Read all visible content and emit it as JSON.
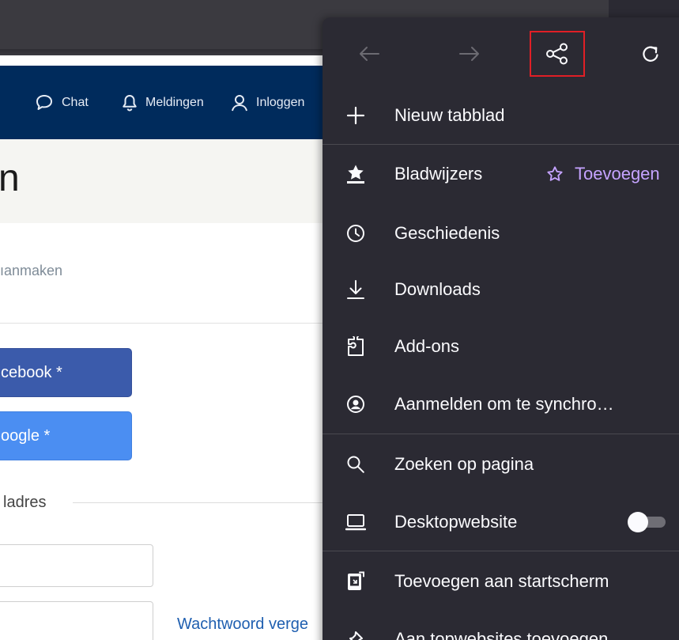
{
  "site": {
    "nav": {
      "chat_label": "Chat",
      "notifications_label": "Meldingen",
      "login_label": "Inloggen"
    },
    "hero_text": "n",
    "create_account_text": "ıanmaken",
    "facebook_button": "cebook *",
    "google_button": "oogle *",
    "email_label": "ladres",
    "forgot_password_link": "Wachtwoord verge"
  },
  "menu": {
    "toolbar": {
      "icons": [
        "back-arrow-icon",
        "forward-arrow-icon",
        "share-icon",
        "reload-icon"
      ]
    },
    "items": [
      {
        "label": "Nieuw tabblad",
        "icon": "plus-icon"
      },
      {
        "label": "Bladwijzers",
        "icon": "bookmarks-icon",
        "action_label": "Toevoegen"
      },
      {
        "label": "Geschiedenis",
        "icon": "clock-icon"
      },
      {
        "label": "Downloads",
        "icon": "download-icon"
      },
      {
        "label": "Add-ons",
        "icon": "puzzle-icon"
      },
      {
        "label": "Aanmelden om te synchro…",
        "icon": "account-icon"
      },
      {
        "label": "Zoeken op pagina",
        "icon": "search-icon"
      },
      {
        "label": "Desktopwebsite",
        "icon": "laptop-icon",
        "toggle_on": false
      },
      {
        "label": "Toevoegen aan startscherm",
        "icon": "add-to-homescreen-icon"
      },
      {
        "label": "Aan topwebsites toevoegen",
        "icon": "pin-icon"
      }
    ]
  },
  "colors": {
    "menu_bg": "#2b2a33",
    "site_nav_bg": "#002b5c",
    "accent_purple": "#c5a3ff",
    "highlight_red": "#e01f26"
  }
}
